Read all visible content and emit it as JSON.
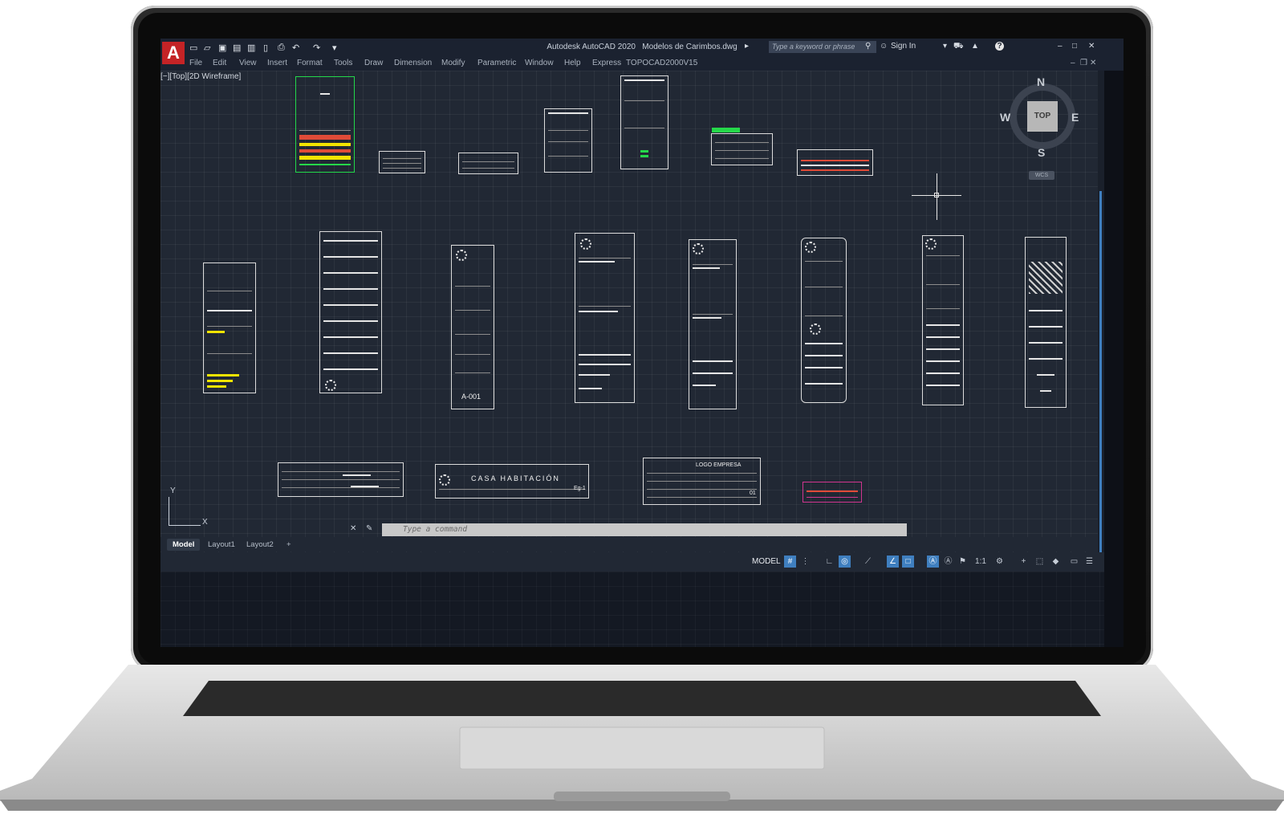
{
  "window": {
    "title": "Autodesk AutoCAD 2020",
    "document": "Modelos de Carimbos.dwg",
    "search_placeholder": "Type a keyword or phrase",
    "sign_in": "Sign In",
    "help": "?"
  },
  "app_logo": "A",
  "menu": [
    "File",
    "Edit",
    "View",
    "Insert",
    "Format",
    "Tools",
    "Draw",
    "Dimension",
    "Modify",
    "Parametric",
    "Window",
    "Help",
    "Express",
    "TOPOCAD2000V15"
  ],
  "viewport_label": "[−][Top][2D Wireframe]",
  "viewcube": {
    "north": "N",
    "south": "S",
    "east": "E",
    "west": "W",
    "face": "TOP",
    "ucs": "WCS"
  },
  "ucs_icon": {
    "x": "X",
    "y": "Y"
  },
  "drawing_labels": {
    "sheet_code": "A-001",
    "casa": "CASA HABITACIÓN",
    "logo_empresa": "LOGO EMPRESA",
    "sheet_number": "01",
    "small_code": "Eg-1"
  },
  "command_line": {
    "placeholder": "Type a command"
  },
  "layout_tabs": [
    "Model",
    "Layout1",
    "Layout2"
  ],
  "add_tab": "+",
  "status_bar": {
    "model": "MODEL",
    "scale": "1:1"
  },
  "colors": {
    "drawing_bg": "#212834",
    "ui_bg": "#1b2230",
    "accent_red": "#c42326",
    "accent_blue": "#3f7fbf"
  }
}
